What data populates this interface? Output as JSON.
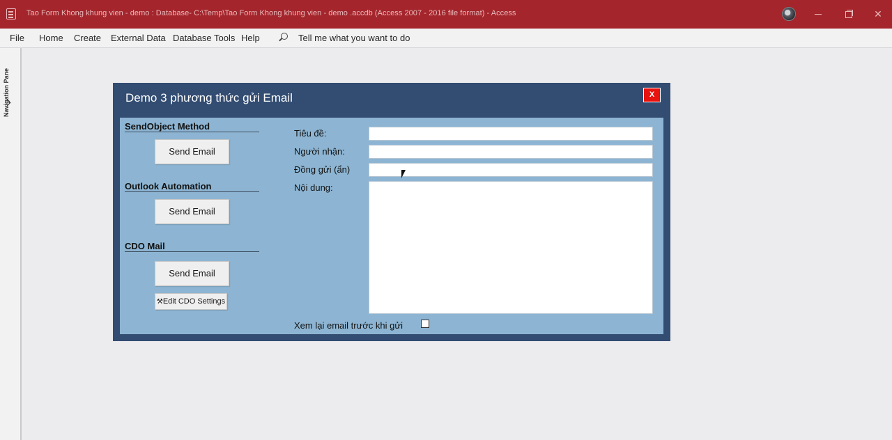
{
  "window": {
    "title": "Tao Form Khong khung vien - demo  : Database- C:\\Temp\\Tao Form Khong khung vien - demo .accdb (Access 2007 - 2016 file format)  -  Access",
    "app_icon": "access-icon",
    "accent_color": "#a4262c"
  },
  "menu": {
    "items": [
      "File",
      "Home",
      "Create",
      "External Data",
      "Database Tools",
      "Help"
    ],
    "tell_me": "Tell me what you want to do"
  },
  "nav_pane": {
    "label": "Navigation Pane"
  },
  "form": {
    "title": "Demo 3 phương thức gửi Email",
    "close_label": "X",
    "sections": [
      {
        "title": "SendObject Method",
        "button": "Send Email"
      },
      {
        "title": "Outlook Automation",
        "button": "Send Email"
      },
      {
        "title": "CDO Mail",
        "button": "Send Email"
      }
    ],
    "cdo_settings_label": "Edit CDO Settings",
    "fields": {
      "subject_label": "Tiêu đề:",
      "to_label": "Người nhận:",
      "bcc_label": "Đồng gửi (ẩn)",
      "body_label": "Nội dung:",
      "subject_value": "",
      "to_value": "",
      "bcc_value": "",
      "body_value": ""
    },
    "preview_label": "Xem lại email trước khi gửi",
    "preview_checked": false,
    "header_color": "#324c72",
    "body_color": "#8db5d3"
  }
}
